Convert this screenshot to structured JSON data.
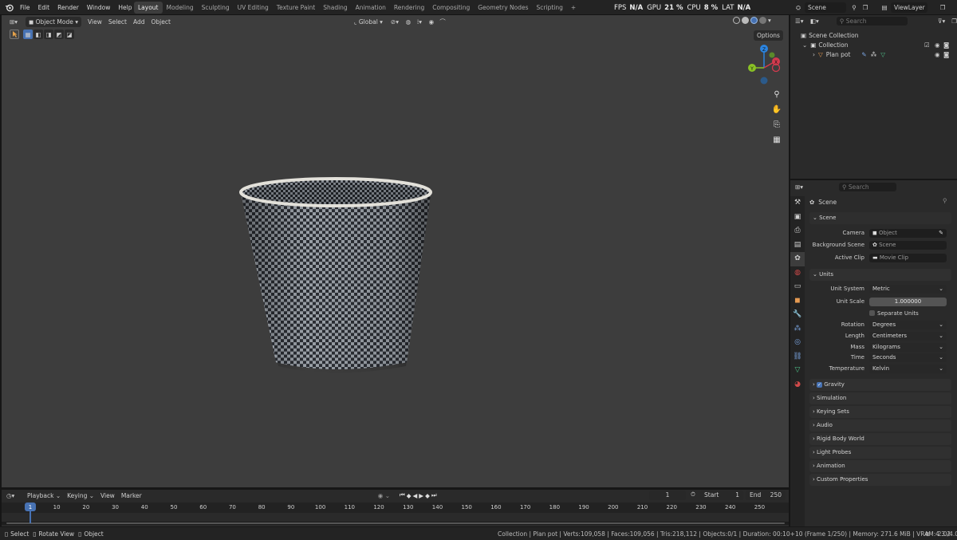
{
  "menus": [
    "File",
    "Edit",
    "Render",
    "Window",
    "Help"
  ],
  "workspaces": [
    "Layout",
    "Modeling",
    "Sculpting",
    "UV Editing",
    "Texture Paint",
    "Shading",
    "Animation",
    "Rendering",
    "Compositing",
    "Geometry Nodes",
    "Scripting"
  ],
  "add_workspace": "+",
  "perf": {
    "fps_label": "FPS",
    "fps": "N/A",
    "gpu_label": "GPU",
    "gpu": "21 %",
    "cpu_label": "CPU",
    "cpu": "8 %",
    "lat_label": "LAT",
    "lat": "N/A"
  },
  "scene": {
    "label": "Scene",
    "viewlayer": "ViewLayer"
  },
  "viewport": {
    "mode": "Object Mode",
    "menus": [
      "View",
      "Select",
      "Add",
      "Object"
    ],
    "orientation": "Global",
    "options": "Options"
  },
  "gizmo": {
    "x": "X",
    "y": "Y",
    "z": "Z"
  },
  "outliner": {
    "search_placeholder": "Search",
    "scene_collection": "Scene Collection",
    "collection": "Collection",
    "object": "Plan pot"
  },
  "properties": {
    "search_placeholder": "Search",
    "context": "Scene",
    "scene_section": "Scene",
    "camera_label": "Camera",
    "camera_value": "Object",
    "background_label": "Background Scene",
    "background_value": "Scene",
    "clip_label": "Active Clip",
    "clip_value": "Movie Clip",
    "units_section": "Units",
    "unit_system_label": "Unit System",
    "unit_system": "Metric",
    "unit_scale_label": "Unit Scale",
    "unit_scale": "1.000000",
    "separate_units": "Separate Units",
    "rotation_label": "Rotation",
    "rotation": "Degrees",
    "length_label": "Length",
    "length": "Centimeters",
    "mass_label": "Mass",
    "mass": "Kilograms",
    "time_label": "Time",
    "time": "Seconds",
    "temperature_label": "Temperature",
    "temperature": "Kelvin",
    "panels": [
      "Gravity",
      "Simulation",
      "Keying Sets",
      "Audio",
      "Rigid Body World",
      "Light Probes",
      "Animation",
      "Custom Properties"
    ]
  },
  "timeline": {
    "menus": [
      "Playback",
      "Keying",
      "View",
      "Marker"
    ],
    "current_frame": "1",
    "start_label": "Start",
    "start": "1",
    "end_label": "End",
    "end": "250",
    "ticks": [
      "1",
      "10",
      "20",
      "30",
      "40",
      "50",
      "60",
      "70",
      "80",
      "90",
      "100",
      "110",
      "120",
      "130",
      "140",
      "150",
      "160",
      "170",
      "180",
      "190",
      "200",
      "210",
      "220",
      "230",
      "240",
      "250"
    ]
  },
  "status": {
    "select": "Select",
    "rotate": "Rotate View",
    "object": "Object",
    "info": "Collection | Plan pot | Verts:109,058 | Faces:109,056 | Tris:218,112 | Objects:0/1 | Duration: 00:10+10 (Frame 1/250) | Memory: 271.6 MiB | VRAM: 2.0/4.0 GiB",
    "version": "4.3.2"
  },
  "colors": {
    "accent": "#4772b3",
    "active_frame": "#4772b3",
    "x_axis": "#d33a4e",
    "y_axis": "#8ac226",
    "z_axis": "#2b84e0"
  }
}
